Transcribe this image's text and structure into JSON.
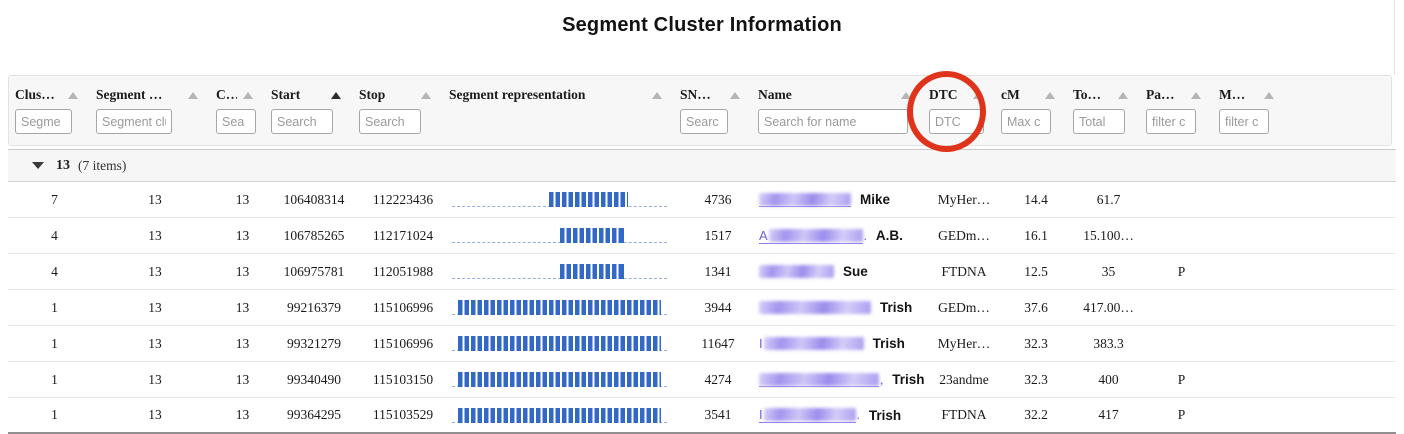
{
  "page": {
    "title": "Segment Cluster Information"
  },
  "columns": [
    {
      "key": "cluster",
      "label": "Clus…",
      "placeholder": "Segme",
      "sort": "inactive",
      "input_width": 57
    },
    {
      "key": "segment_cluster",
      "label": "Segment …",
      "placeholder": "Segment clu",
      "sort": "inactive",
      "input_width": 76
    },
    {
      "key": "chromosome",
      "label": "C…",
      "placeholder": "Sea",
      "sort": "inactive",
      "input_width": 40
    },
    {
      "key": "start",
      "label": "Start",
      "placeholder": "Search",
      "sort": "active",
      "input_width": 62
    },
    {
      "key": "stop",
      "label": "Stop",
      "placeholder": "Search",
      "sort": "inactive",
      "input_width": 62
    },
    {
      "key": "segment",
      "label": "Segment representation",
      "placeholder": null,
      "sort": "inactive",
      "input_width": 0
    },
    {
      "key": "snps",
      "label": "SN…",
      "placeholder": "Searc",
      "sort": "inactive",
      "input_width": 48
    },
    {
      "key": "name",
      "label": "Name",
      "placeholder": "Search for name",
      "sort": "inactive",
      "input_width": 150
    },
    {
      "key": "dtc",
      "label": "DTC",
      "placeholder": "DTC",
      "sort": "inactive",
      "input_width": 55
    },
    {
      "key": "cm",
      "label": "cM",
      "placeholder": "Max c",
      "sort": "inactive",
      "input_width": 50
    },
    {
      "key": "total",
      "label": "To…",
      "placeholder": "Total",
      "sort": "inactive",
      "input_width": 52
    },
    {
      "key": "paternal",
      "label": "Pa…",
      "placeholder": "filter c",
      "sort": "inactive",
      "input_width": 50
    },
    {
      "key": "maternal",
      "label": "M…",
      "placeholder": "filter c",
      "sort": "inactive",
      "input_width": 50
    }
  ],
  "group": {
    "value": "13",
    "count": "(7 items)"
  },
  "rows": [
    {
      "cluster": "7",
      "segment_cluster": "13",
      "chromosome": "13",
      "start": "106408314",
      "stop": "112223436",
      "bar": {
        "left_pct": 45,
        "width_pct": 37
      },
      "snps": "4736",
      "name": {
        "prefix": "",
        "blur_width": 92,
        "suffix": "",
        "underline": true,
        "annotation": "Mike"
      },
      "dtc": "MyHer…",
      "cm": "14.4",
      "total": "61.7",
      "paternal": "",
      "maternal": ""
    },
    {
      "cluster": "4",
      "segment_cluster": "13",
      "chromosome": "13",
      "start": "106785265",
      "stop": "112171024",
      "bar": {
        "left_pct": 50,
        "width_pct": 30
      },
      "snps": "1517",
      "name": {
        "prefix": "A",
        "blur_width": 94,
        "suffix": ".",
        "underline": true,
        "annotation": "A.B."
      },
      "dtc": "GEDm…",
      "cm": "16.1",
      "total": "15.100…",
      "paternal": "",
      "maternal": ""
    },
    {
      "cluster": "4",
      "segment_cluster": "13",
      "chromosome": "13",
      "start": "106975781",
      "stop": "112051988",
      "bar": {
        "left_pct": 50,
        "width_pct": 30
      },
      "snps": "1341",
      "name": {
        "prefix": "",
        "blur_width": 75,
        "suffix": "",
        "underline": false,
        "annotation": "Sue"
      },
      "dtc": "FTDNA",
      "cm": "12.5",
      "total": "35",
      "paternal": "P",
      "maternal": ""
    },
    {
      "cluster": "1",
      "segment_cluster": "13",
      "chromosome": "13",
      "start": "99216379",
      "stop": "115106996",
      "bar": {
        "left_pct": 3,
        "width_pct": 94
      },
      "snps": "3944",
      "name": {
        "prefix": "",
        "blur_width": 112,
        "suffix": "",
        "underline": false,
        "annotation": "Trish"
      },
      "dtc": "GEDm…",
      "cm": "37.6",
      "total": "417.00…",
      "paternal": "",
      "maternal": ""
    },
    {
      "cluster": "1",
      "segment_cluster": "13",
      "chromosome": "13",
      "start": "99321279",
      "stop": "115106996",
      "bar": {
        "left_pct": 3,
        "width_pct": 94
      },
      "snps": "11647",
      "name": {
        "prefix": "I",
        "blur_width": 100,
        "suffix": "",
        "underline": false,
        "annotation": "Trish"
      },
      "dtc": "MyHer…",
      "cm": "32.3",
      "total": "383.3",
      "paternal": "",
      "maternal": ""
    },
    {
      "cluster": "1",
      "segment_cluster": "13",
      "chromosome": "13",
      "start": "99340490",
      "stop": "115103150",
      "bar": {
        "left_pct": 3,
        "width_pct": 94
      },
      "snps": "4274",
      "name": {
        "prefix": "",
        "blur_width": 120,
        "suffix": ",",
        "underline": true,
        "annotation": "Trish"
      },
      "dtc": "23andme",
      "cm": "32.3",
      "total": "400",
      "paternal": "P",
      "maternal": ""
    },
    {
      "cluster": "1",
      "segment_cluster": "13",
      "chromosome": "13",
      "start": "99364295",
      "stop": "115103529",
      "bar": {
        "left_pct": 3,
        "width_pct": 94
      },
      "snps": "3541",
      "name": {
        "prefix": "I",
        "blur_width": 92,
        "suffix": ".",
        "underline": true,
        "annotation": "Trish"
      },
      "dtc": "FTDNA",
      "cm": "32.2",
      "total": "417",
      "paternal": "P",
      "maternal": ""
    }
  ],
  "annotation_circle": {
    "color": "#e0331c",
    "target": "dtc-column"
  }
}
